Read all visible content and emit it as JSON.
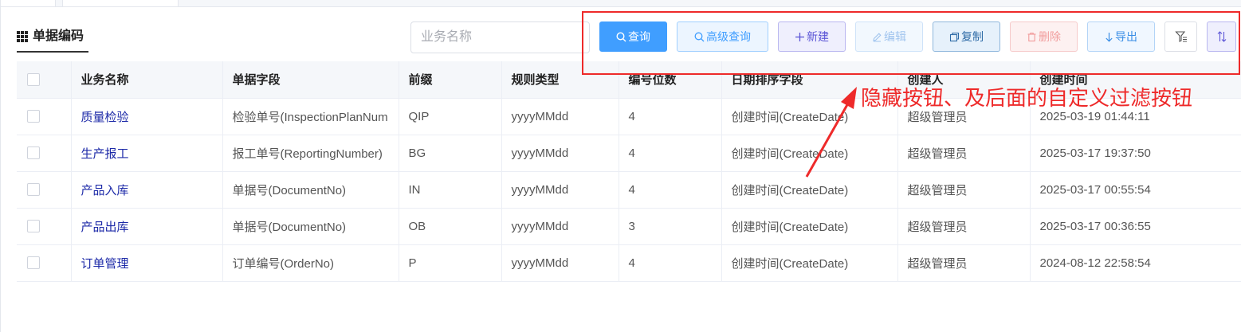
{
  "title": "单据编码",
  "search": {
    "placeholder": "业务名称"
  },
  "toolbar": {
    "query": "查询",
    "advanced_query": "高级查询",
    "new": "新建",
    "edit": "编辑",
    "copy": "复制",
    "delete": "删除",
    "export": "导出"
  },
  "annotation": "隐藏按钮、及后面的自定义过滤按钮",
  "colors": {
    "primary": "#409eff",
    "annotation": "#ee2a2a",
    "link": "#1d2aa8"
  },
  "table": {
    "columns": [
      "业务名称",
      "单据字段",
      "前缀",
      "规则类型",
      "编号位数",
      "日期排序字段",
      "创建人",
      "创建时间"
    ],
    "rows": [
      [
        "质量检验",
        "检验单号(InspectionPlanNum",
        "QIP",
        "yyyyMMdd",
        "4",
        "创建时间(CreateDate)",
        "超级管理员",
        "2025-03-19 01:44:11"
      ],
      [
        "生产报工",
        "报工单号(ReportingNumber)",
        "BG",
        "yyyyMMdd",
        "4",
        "创建时间(CreateDate)",
        "超级管理员",
        "2025-03-17 19:37:50"
      ],
      [
        "产品入库",
        "单据号(DocumentNo)",
        "IN",
        "yyyyMMdd",
        "4",
        "创建时间(CreateDate)",
        "超级管理员",
        "2025-03-17 00:55:54"
      ],
      [
        "产品出库",
        "单据号(DocumentNo)",
        "OB",
        "yyyyMMdd",
        "3",
        "创建时间(CreateDate)",
        "超级管理员",
        "2025-03-17 00:36:55"
      ],
      [
        "订单管理",
        "订单编号(OrderNo)",
        "P",
        "yyyyMMdd",
        "4",
        "创建时间(CreateDate)",
        "超级管理员",
        "2024-08-12 22:58:54"
      ]
    ]
  }
}
